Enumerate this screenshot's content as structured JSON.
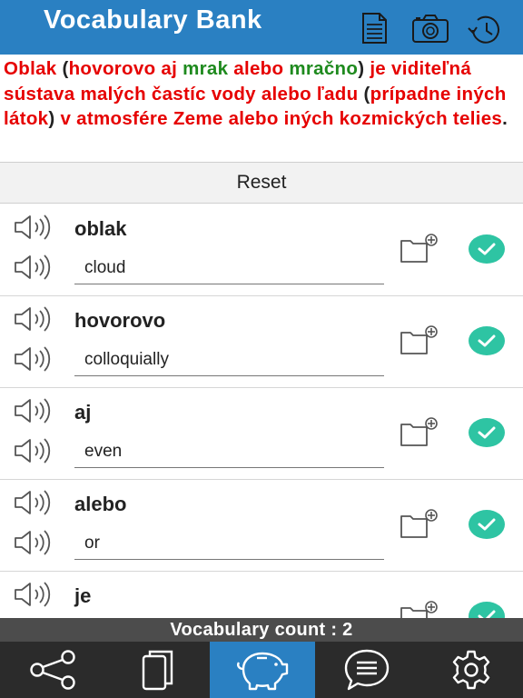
{
  "header": {
    "title": "Vocabulary Bank",
    "icons": [
      "document-icon",
      "camera-icon",
      "history-icon"
    ]
  },
  "sentence": {
    "segments": [
      {
        "text": "Oblak",
        "color": "#e60000"
      },
      {
        "text": " (",
        "color": "#222222"
      },
      {
        "text": "hovorovo aj",
        "color": "#e60000"
      },
      {
        "text": " mrak ",
        "color": "#1e8a1e"
      },
      {
        "text": "alebo",
        "color": "#e60000"
      },
      {
        "text": " mračno",
        "color": "#1e8a1e"
      },
      {
        "text": ") ",
        "color": "#222222"
      },
      {
        "text": "je viditeľná sústava malých častíc vody alebo ľadu",
        "color": "#e60000"
      },
      {
        "text": " (",
        "color": "#222222"
      },
      {
        "text": "prípadne iných látok",
        "color": "#e60000"
      },
      {
        "text": ") ",
        "color": "#222222"
      },
      {
        "text": "v atmosfére Zeme alebo iných kozmických telies",
        "color": "#e60000"
      },
      {
        "text": ".",
        "color": "#222222"
      }
    ]
  },
  "reset_label": "Reset",
  "vocabulary": [
    {
      "word": "oblak",
      "translation": "cloud"
    },
    {
      "word": "hovorovo",
      "translation": "colloquially"
    },
    {
      "word": "aj",
      "translation": "even"
    },
    {
      "word": "alebo",
      "translation": "or"
    },
    {
      "word": "je",
      "translation": ""
    }
  ],
  "count_label": "Vocabulary count : 2",
  "tabs": [
    {
      "icon": "share-icon",
      "active": false
    },
    {
      "icon": "cards-icon",
      "active": false
    },
    {
      "icon": "piggy-bank-icon",
      "active": true
    },
    {
      "icon": "chat-icon",
      "active": false
    },
    {
      "icon": "settings-icon",
      "active": false
    }
  ],
  "colors": {
    "header_bg": "#2a80c2",
    "check": "#2ec4a3",
    "tab_active": "#2a80c2",
    "tabbar_bg": "#2b2b2b"
  }
}
